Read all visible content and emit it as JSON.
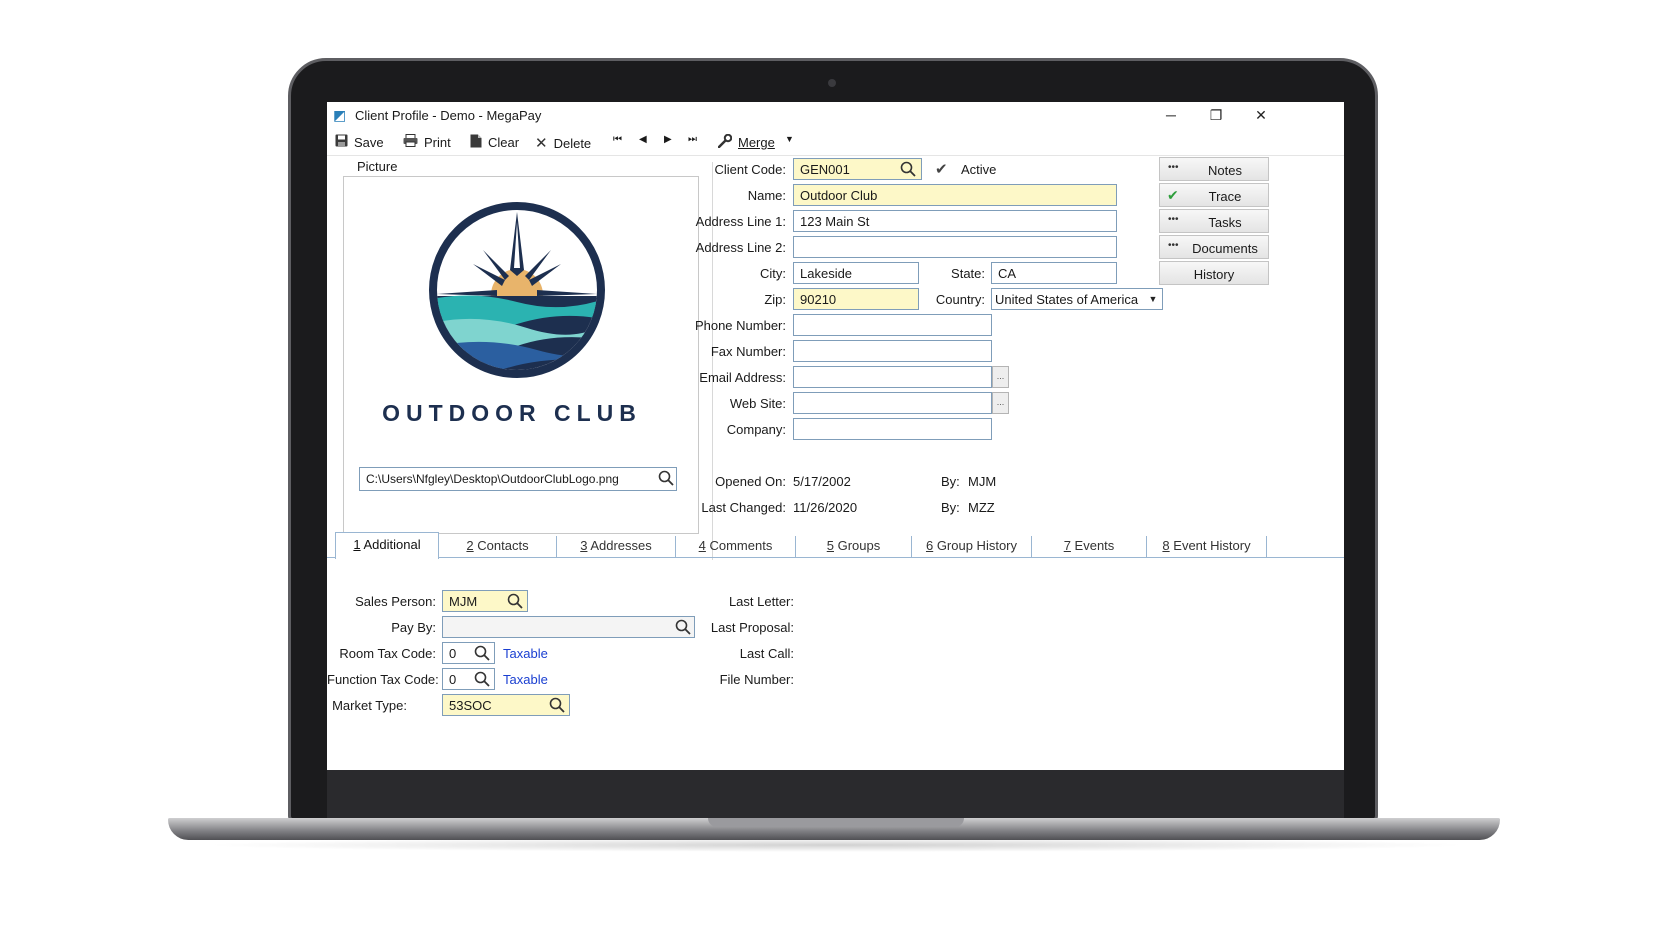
{
  "window": {
    "title": "Client Profile - Demo - MegaPay",
    "minimize": "─",
    "maximize": "❐",
    "close": "✕"
  },
  "toolbar": {
    "save": "Save",
    "print": "Print",
    "clear": "Clear",
    "delete": "Delete",
    "merge": "Merge"
  },
  "picture": {
    "legend": "Picture",
    "logo_text": "OUTDOOR CLUB",
    "path": "C:\\Users\\Nfgley\\Desktop\\OutdoorClubLogo.png"
  },
  "client": {
    "code_label": "Client Code:",
    "code": "GEN001",
    "active_label": "Active",
    "name_label": "Name:",
    "name": "Outdoor Club",
    "address1_label": "Address Line 1:",
    "address1": "123 Main St",
    "address2_label": "Address Line 2:",
    "address2": "",
    "city_label": "City:",
    "city": "Lakeside",
    "state_label": "State:",
    "state": "CA",
    "zip_label": "Zip:",
    "zip": "90210",
    "country_label": "Country:",
    "country": "United States of America",
    "phone_label": "Phone Number:",
    "phone": "",
    "fax_label": "Fax Number:",
    "fax": "",
    "email_label": "Email Address:",
    "email": "",
    "website_label": "Web Site:",
    "website": "",
    "company_label": "Company:",
    "company": "",
    "opened_label": "Opened On:",
    "opened": "5/17/2002",
    "opened_by_label": "By:",
    "opened_by": "MJM",
    "changed_label": "Last Changed:",
    "changed": "11/26/2020",
    "changed_by_label": "By:",
    "changed_by": "MZZ"
  },
  "side_buttons": {
    "notes": "Notes",
    "trace": "Trace",
    "tasks": "Tasks",
    "documents": "Documents",
    "history": "History"
  },
  "tabs": [
    {
      "key": "1",
      "label": " Additional"
    },
    {
      "key": "2",
      "label": " Contacts"
    },
    {
      "key": "3",
      "label": " Addresses"
    },
    {
      "key": "4",
      "label": " Comments"
    },
    {
      "key": "5",
      "label": " Groups"
    },
    {
      "key": "6",
      "label": " Group History"
    },
    {
      "key": "7",
      "label": " Events"
    },
    {
      "key": "8",
      "label": " Event History"
    }
  ],
  "additional": {
    "sales_person_label": "Sales Person:",
    "sales_person": "MJM",
    "pay_by_label": "Pay By:",
    "pay_by": "",
    "room_tax_label": "Room Tax Code:",
    "room_tax": "0",
    "room_tax_link": "Taxable",
    "function_tax_label": "Function Tax Code:",
    "function_tax": "0",
    "function_tax_link": "Taxable",
    "market_type_label": "Market Type:",
    "market_type": "53SOC",
    "last_letter_label": "Last Letter:",
    "last_proposal_label": "Last Proposal:",
    "last_call_label": "Last Call:",
    "file_number_label": "File Number:"
  },
  "icons": {
    "search": "⌕",
    "check": "✔",
    "dots": "•••"
  },
  "colors": {
    "required_field": "#fdf8c8",
    "link": "#1a3fd1",
    "trace_check": "#2e9e3c",
    "logo_navy": "#1d2f4f",
    "logo_teal": "#2bb3b1",
    "logo_sun": "#e8b46b"
  }
}
